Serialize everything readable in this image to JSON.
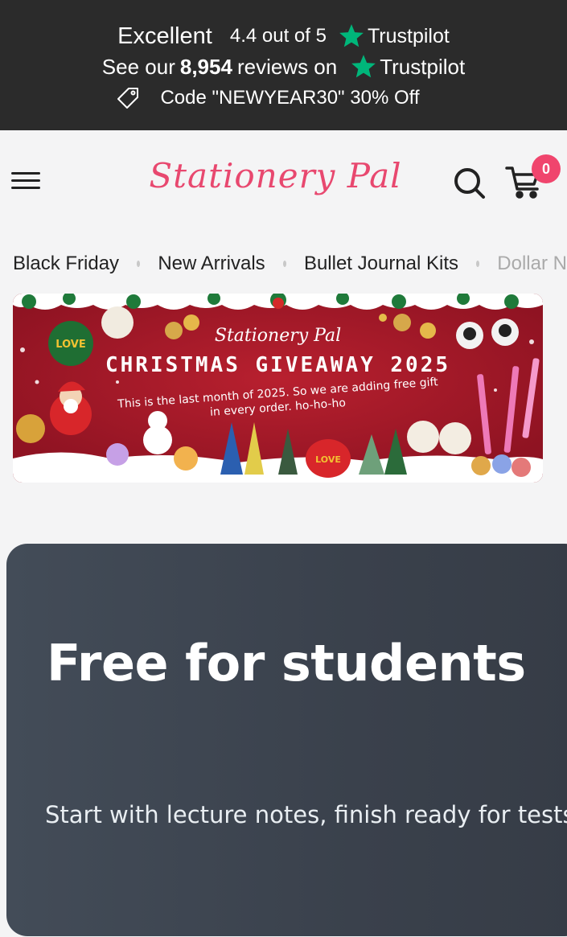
{
  "trustbar": {
    "rating_word": "Excellent",
    "score_text": "4.4 out of 5",
    "brand": "Trustpilot",
    "reviews_pre": "See our",
    "reviews_count": "8,954",
    "reviews_post": "reviews on",
    "promo_code_text": "Code \"NEWYEAR30\" 30% Off",
    "star_color": "#00b67a"
  },
  "header": {
    "logo": "Stationery Pal",
    "logo_color": "#e8486f",
    "cart_count": "0"
  },
  "categories": [
    {
      "label": "Black Friday"
    },
    {
      "label": "New Arrivals"
    },
    {
      "label": "Bullet Journal Kits"
    },
    {
      "label": "Dollar N"
    }
  ],
  "banner": {
    "brand": "Stationery Pal",
    "title": "CHRISTMAS GIVEAWAY 2025",
    "line1": "This is the last month of 2025.  So we are adding free gift",
    "line2": "in every order.  ho-ho-ho",
    "ornament_text": "LOVE"
  },
  "promo": {
    "title": "Free for students",
    "subtitle": "Start with lecture notes, finish ready for tests"
  }
}
